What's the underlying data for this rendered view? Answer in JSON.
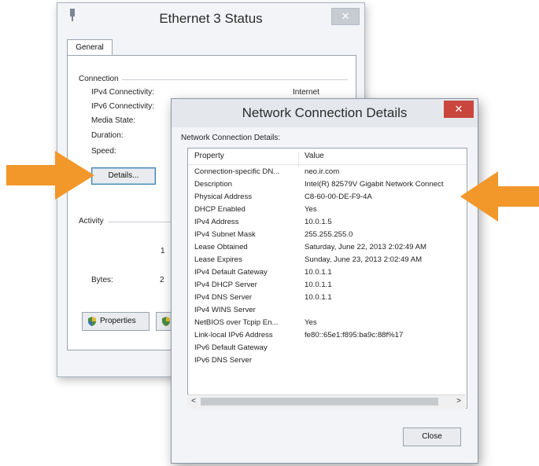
{
  "ethernet_window": {
    "title": "Ethernet 3 Status",
    "tab": "General",
    "connection_group": "Connection",
    "rows": [
      {
        "label": "IPv4 Connectivity:",
        "value": "Internet"
      },
      {
        "label": "IPv6 Connectivity:",
        "value": ""
      },
      {
        "label": "Media State:",
        "value": ""
      },
      {
        "label": "Duration:",
        "value": ""
      },
      {
        "label": "Speed:",
        "value": ""
      }
    ],
    "details_button": "Details...",
    "activity_group": "Activity",
    "activity_partial": "1",
    "bytes_label": "Bytes:",
    "bytes_partial": "2",
    "properties_button": "Properties",
    "close_glyph": "✕"
  },
  "details_window": {
    "title": "Network Connection Details",
    "caption": "Network Connection Details:",
    "columns": {
      "property": "Property",
      "value": "Value"
    },
    "rows": [
      {
        "property": "Connection-specific DN...",
        "value": "neo.ir.com"
      },
      {
        "property": "Description",
        "value": "Intel(R) 82579V Gigabit Network Connect"
      },
      {
        "property": "Physical Address",
        "value": "C8-60-00-DE-F9-4A"
      },
      {
        "property": "DHCP Enabled",
        "value": "Yes"
      },
      {
        "property": "IPv4 Address",
        "value": "10.0.1.5"
      },
      {
        "property": "IPv4 Subnet Mask",
        "value": "255.255.255.0"
      },
      {
        "property": "Lease Obtained",
        "value": "Saturday, June 22, 2013 2:02:49 AM"
      },
      {
        "property": "Lease Expires",
        "value": "Sunday, June 23, 2013 2:02:49 AM"
      },
      {
        "property": "IPv4 Default Gateway",
        "value": "10.0.1.1"
      },
      {
        "property": "IPv4 DHCP Server",
        "value": "10.0.1.1"
      },
      {
        "property": "IPv4 DNS Server",
        "value": "10.0.1.1"
      },
      {
        "property": "IPv4 WINS Server",
        "value": ""
      },
      {
        "property": "NetBIOS over Tcpip En...",
        "value": "Yes"
      },
      {
        "property": "Link-local IPv6 Address",
        "value": "fe80::65e1:f895:ba9c:88f%17"
      },
      {
        "property": "IPv6 Default Gateway",
        "value": ""
      },
      {
        "property": "IPv6 DNS Server",
        "value": ""
      }
    ],
    "close_button": "Close",
    "close_glyph": "✕",
    "scroll_left": "<",
    "scroll_right": ">"
  },
  "icons": [
    "app-network-icon",
    "properties-shield-icon",
    "close-icon"
  ],
  "colors": {
    "arrow": "#f2972a",
    "close_active": "#c9463d"
  }
}
